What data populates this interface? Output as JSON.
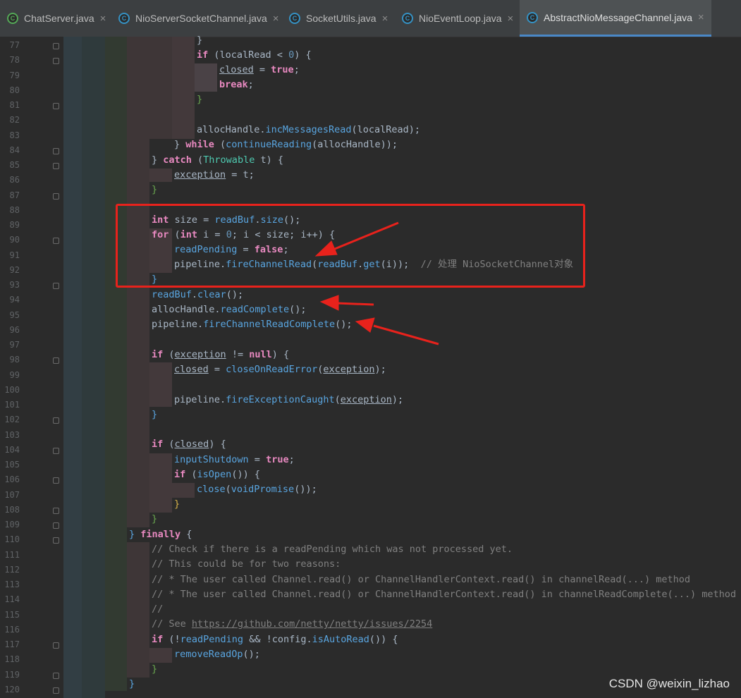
{
  "tabs": [
    {
      "label": "ChatServer.java",
      "icon": "run-class-icon",
      "active": false
    },
    {
      "label": "NioServerSocketChannel.java",
      "icon": "class-icon",
      "active": false
    },
    {
      "label": "SocketUtils.java",
      "icon": "class-icon",
      "active": false
    },
    {
      "label": "NioEventLoop.java",
      "icon": "class-icon",
      "active": false
    },
    {
      "label": "AbstractNioMessageChannel.java",
      "icon": "class-icon",
      "active": true
    }
  ],
  "close_glyph": "×",
  "line_numbers": [
    "77",
    "78",
    "79",
    "80",
    "81",
    "82",
    "83",
    "84",
    "85",
    "86",
    "87",
    "88",
    "89",
    "90",
    "91",
    "92",
    "93",
    "94",
    "95",
    "96",
    "97",
    "98",
    "99",
    "100",
    "101",
    "102",
    "103",
    "104",
    "105",
    "106",
    "107",
    "108",
    "109",
    "110",
    "111",
    "112",
    "113",
    "114",
    "115",
    "116",
    "117",
    "118",
    "119",
    "120"
  ],
  "code": {
    "l77": "}",
    "l78_if": "if",
    "l78_rest_a": " (localRead < ",
    "l78_num": "0",
    "l78_rest_b": ") {",
    "l79_var": "closed",
    "l79_eq": " = ",
    "l79_val": "true",
    "l79_semi": ";",
    "l80": "break",
    "l80_semi": ";",
    "l81": "}",
    "l83_a": "allocHandle.",
    "l83_m": "incMessagesRead",
    "l83_b": "(localRead);",
    "l84_a": "} ",
    "l84_kw": "while",
    "l84_b": " (",
    "l84_m": "continueReading",
    "l84_c": "(allocHandle));",
    "l85_a": "} ",
    "l85_kw": "catch",
    "l85_b": " (",
    "l85_cls": "Throwable",
    "l85_c": " t) {",
    "l86_var": "exception",
    "l86_b": " = t;",
    "l87": "}",
    "l89_kw": "int",
    "l89_a": " size = ",
    "l89_f": "readBuf",
    "l89_b": ".",
    "l89_m": "size",
    "l89_c": "();",
    "l90_kw": "for",
    "l90_a": " (",
    "l90_kw2": "int",
    "l90_b": " i = ",
    "l90_num": "0",
    "l90_c": "; i < size; i++) {",
    "l91_f": "readPending",
    "l91_a": " = ",
    "l91_val": "false",
    "l91_b": ";",
    "l92_a": "pipeline.",
    "l92_m": "fireChannelRead",
    "l92_b": "(",
    "l92_f": "readBuf",
    "l92_c": ".",
    "l92_m2": "get",
    "l92_d": "(i));  ",
    "l92_cmt": "// 处理 NioSocketChannel对象",
    "l93": "}",
    "l94_f": "readBuf",
    "l94_a": ".",
    "l94_m": "clear",
    "l94_b": "();",
    "l95_a": "allocHandle.",
    "l95_m": "readComplete",
    "l95_b": "();",
    "l96_a": "pipeline.",
    "l96_m": "fireChannelReadComplete",
    "l96_b": "();",
    "l98_kw": "if",
    "l98_a": " (",
    "l98_var": "exception",
    "l98_b": " != ",
    "l98_null": "null",
    "l98_c": ") {",
    "l99_var": "closed",
    "l99_a": " = ",
    "l99_m": "closeOnReadError",
    "l99_b": "(",
    "l99_var2": "exception",
    "l99_c": ");",
    "l101_a": "pipeline.",
    "l101_m": "fireExceptionCaught",
    "l101_b": "(",
    "l101_var": "exception",
    "l101_c": ");",
    "l102": "}",
    "l104_kw": "if",
    "l104_a": " (",
    "l104_var": "closed",
    "l104_b": ") {",
    "l105_f": "inputShutdown",
    "l105_a": " = ",
    "l105_val": "true",
    "l105_b": ";",
    "l106_kw": "if",
    "l106_a": " (",
    "l106_m": "isOpen",
    "l106_b": "()) {",
    "l107_m": "close",
    "l107_a": "(",
    "l107_m2": "voidPromise",
    "l107_b": "());",
    "l108": "}",
    "l109": "}",
    "l110_a": "} ",
    "l110_kw": "finally",
    "l110_b": " {",
    "l111": "// Check if there is a readPending which was not processed yet.",
    "l112": "// This could be for two reasons:",
    "l113": "// * The user called Channel.read() or ChannelHandlerContext.read() in channelRead(...) method",
    "l114": "// * The user called Channel.read() or ChannelHandlerContext.read() in channelReadComplete(...) method",
    "l115": "//",
    "l116_a": "// See ",
    "l116_url": "https://github.com/netty/netty/issues/2254",
    "l117_kw": "if",
    "l117_a": " (!",
    "l117_f": "readPending",
    "l117_b": " && !config.",
    "l117_m": "isAutoRead",
    "l117_c": "()) {",
    "l118_m": "removeReadOp",
    "l118_a": "();",
    "l119": "}",
    "l120": "}"
  },
  "watermark": "CSDN @weixin_lizhao",
  "colors": {
    "annotation_red": "#e8221c",
    "background": "#2b2b2b"
  }
}
